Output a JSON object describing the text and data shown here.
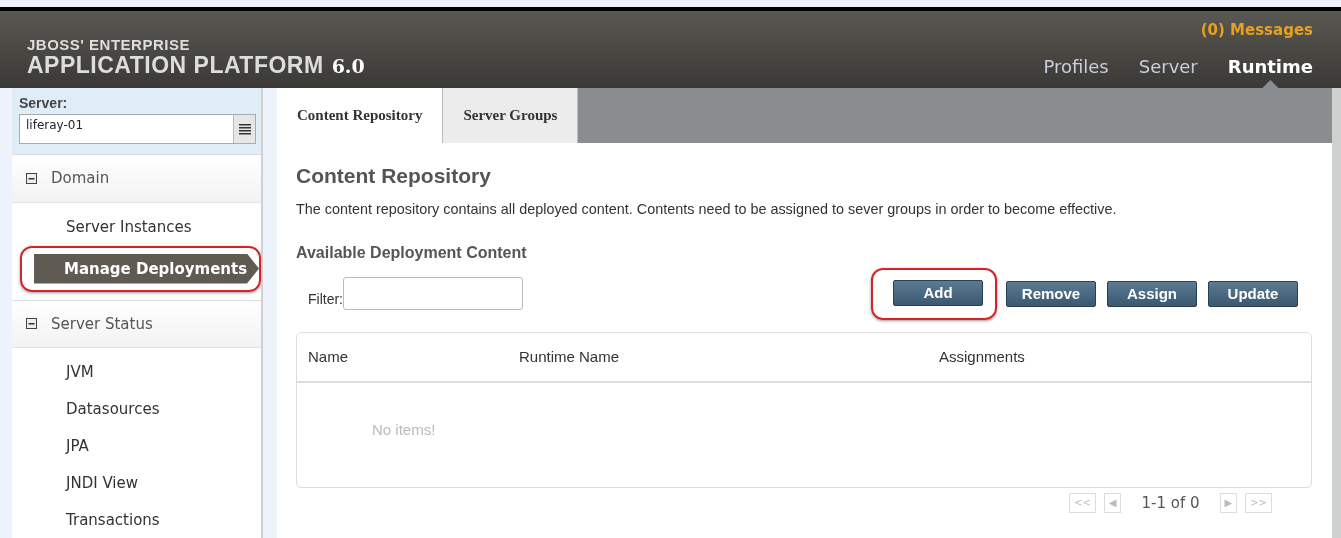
{
  "header": {
    "logo_top": "JBOSS' ENTERPRISE",
    "logo_main": "APPLICATION PLATFORM",
    "logo_version": "6.0",
    "messages": "(0) Messages",
    "nav": [
      {
        "label": "Profiles",
        "selected": false
      },
      {
        "label": "Server",
        "selected": false
      },
      {
        "label": "Runtime",
        "selected": true
      }
    ]
  },
  "sidebar": {
    "server_label": "Server:",
    "server_value": "liferay-01",
    "sections": [
      {
        "label": "Domain",
        "expanded": true,
        "items": [
          {
            "label": "Server Instances",
            "selected": false,
            "highlighted": false
          },
          {
            "label": "Manage Deployments",
            "selected": true,
            "highlighted": true
          }
        ]
      },
      {
        "label": "Server Status",
        "expanded": true,
        "items": [
          {
            "label": "JVM",
            "selected": false,
            "highlighted": false
          },
          {
            "label": "Datasources",
            "selected": false,
            "highlighted": false
          },
          {
            "label": "JPA",
            "selected": false,
            "highlighted": false
          },
          {
            "label": "JNDI View",
            "selected": false,
            "highlighted": false
          },
          {
            "label": "Transactions",
            "selected": false,
            "highlighted": false
          }
        ]
      }
    ]
  },
  "tabs": [
    {
      "label": "Content Repository",
      "selected": true
    },
    {
      "label": "Server Groups",
      "selected": false
    }
  ],
  "content": {
    "title": "Content Repository",
    "description": "The content repository contains all deployed content. Contents need to be assigned to sever groups in order to become effective.",
    "subtitle": "Available Deployment Content",
    "filter_label": "Filter:",
    "buttons": [
      {
        "label": "Add",
        "highlighted": true
      },
      {
        "label": "Remove",
        "highlighted": false
      },
      {
        "label": "Assign",
        "highlighted": false
      },
      {
        "label": "Update",
        "highlighted": false
      }
    ],
    "table": {
      "columns": [
        "Name",
        "Runtime Name",
        "Assignments"
      ],
      "empty_text": "No items!"
    },
    "pager": {
      "first": "<<",
      "prev": "◀",
      "text": "1-1 of 0",
      "next": "▶",
      "last": ">>"
    }
  }
}
